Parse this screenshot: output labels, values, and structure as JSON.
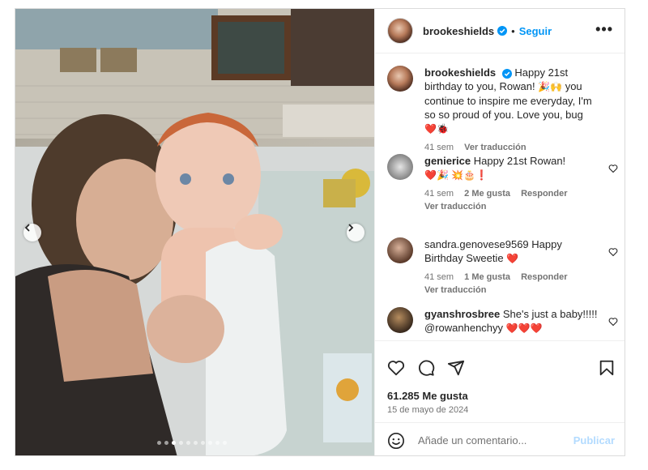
{
  "post": {
    "username": "brookeshields",
    "follow_label": "Seguir",
    "follow_separator": "•",
    "more_label": "•••"
  },
  "caption": {
    "username": "brookeshields",
    "text_part1": "Happy 21st birthday to you, Rowan! ",
    "emoji1": "🎉🙌",
    "text_part2": " you continue to inspire me everyday, I'm so so proud of you. Love you, bug ",
    "emoji2": "❤️🐞",
    "time": "41 sem",
    "translate": "Ver traducción"
  },
  "comments": [
    {
      "username": "genierice",
      "text": "Happy 21st Rowan! ",
      "emoji": "❤️🎉 💥🎂❗",
      "time": "41 sem",
      "likes": "2 Me gusta",
      "reply": "Responder",
      "translate": "Ver traducción"
    },
    {
      "username": "sandra.genovese9569",
      "text": "Happy Birthday Sweetie ",
      "emoji": "❤️",
      "time": "41 sem",
      "likes": "1 Me gusta",
      "reply": "Responder",
      "translate": "Ver traducción"
    },
    {
      "username": "gyanshrosbree",
      "text": "She's just a baby!!!!! @rowanhenchyy ",
      "emoji": "❤️❤️❤️"
    }
  ],
  "likes_count": "61.285 Me gusta",
  "date": "15 de mayo de 2024",
  "comment_input": {
    "placeholder": "Añade un comentario...",
    "publish_label": "Publicar"
  },
  "carousel": {
    "slide_count": 10,
    "active_index": 2
  },
  "colors": {
    "accent": "#0095f6",
    "verified": "#0095f6",
    "muted": "#737373",
    "heart": "#ed4956"
  },
  "icons": [
    "chevron-left-icon",
    "chevron-right-icon",
    "verified-icon",
    "more-icon",
    "heart-icon",
    "comment-icon",
    "share-icon",
    "bookmark-icon",
    "emoji-icon"
  ]
}
